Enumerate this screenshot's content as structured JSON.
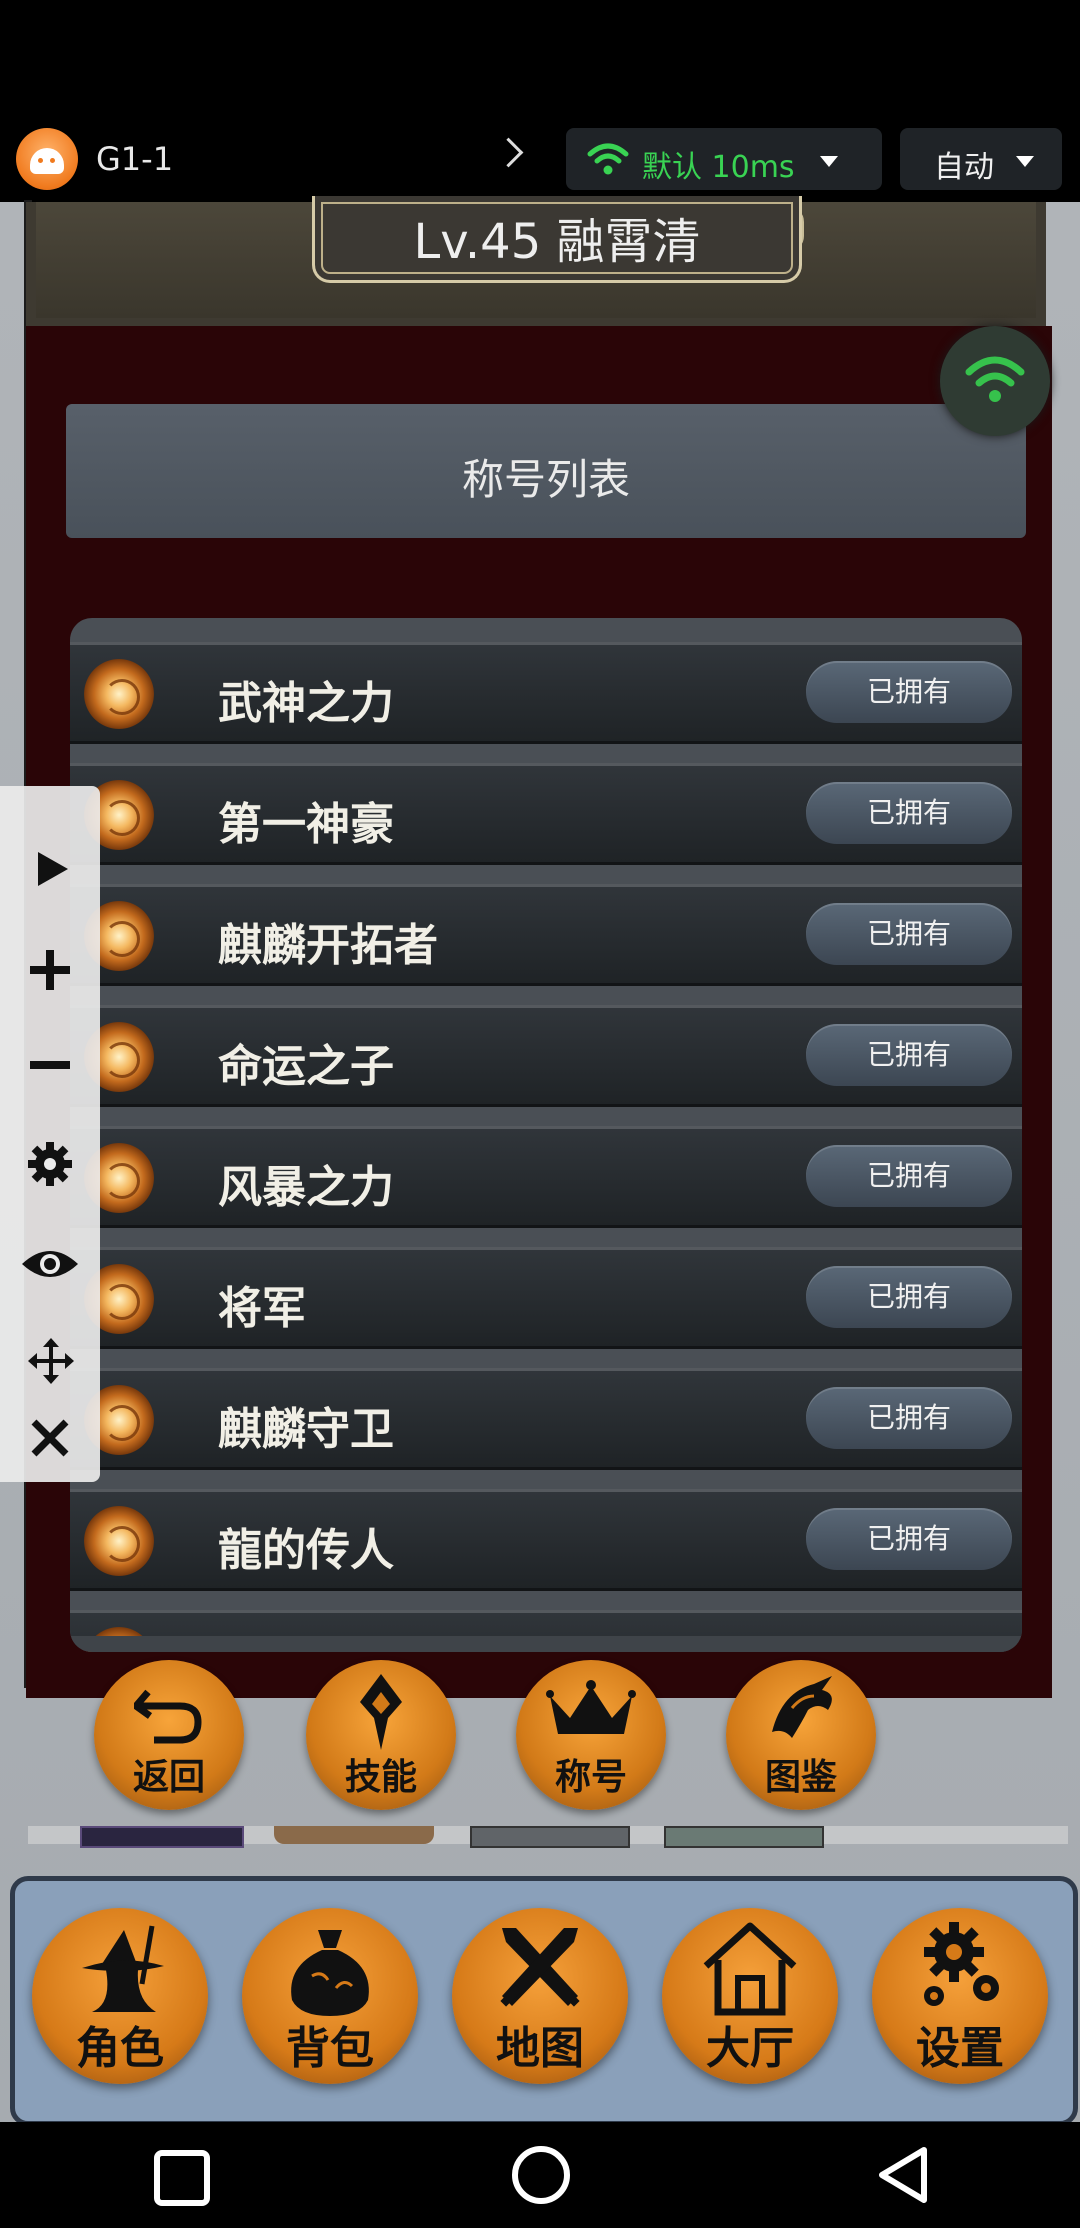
{
  "overlay_bar": {
    "app_name": "G1-1",
    "network_label": "默认 10ms",
    "mode_label": "自动"
  },
  "header": {
    "level_name": "Lv.45 融霄清"
  },
  "panel": {
    "title": "称号列表",
    "owned_label": "已拥有",
    "titles": [
      "武神之力",
      "第一神豪",
      "麒麟开拓者",
      "命运之子",
      "风暴之力",
      "将军",
      "麒麟守卫",
      "龍的传人"
    ]
  },
  "actions": {
    "back": "返回",
    "skills": "技能",
    "title": "称号",
    "codex": "图鉴"
  },
  "bottom_nav": {
    "character": "角色",
    "bag": "背包",
    "map": "地图",
    "lobby": "大厅",
    "settings": "设置"
  },
  "colors": {
    "network_green": "#39d353",
    "button_orange": "#d67a18",
    "panel_dark_red": "#2a0507"
  }
}
